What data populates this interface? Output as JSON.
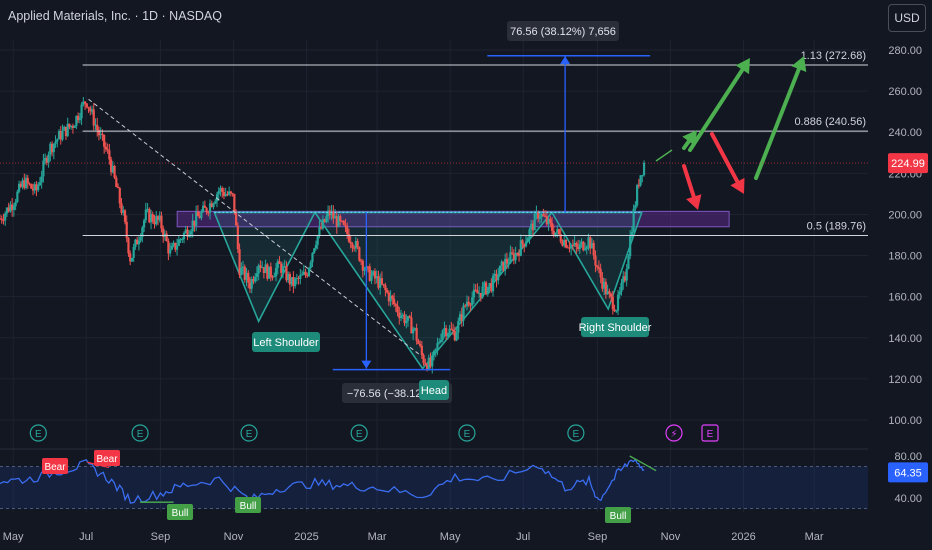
{
  "header": {
    "title": "Applied Materials, Inc. · 1D · NASDAQ",
    "currency_button": "USD"
  },
  "colors": {
    "background": "#131722",
    "grid": "#1f2330",
    "text": "#b2b5be",
    "candle_up": "#26a69a",
    "candle_down": "#ef5350",
    "pattern": "#26a69a",
    "measure": "#2962ff",
    "fib_line": "#d1d4dc",
    "zone": "#5b2a86",
    "arrow_up": "#4caf50",
    "arrow_down": "#f23645",
    "rsi_line": "#3a6df0",
    "price_label": "#f23645"
  },
  "chart_data": [
    {
      "type": "line",
      "name": "price",
      "x": [
        "2024-04-20",
        "2024-05-01",
        "2024-05-10",
        "2024-05-20",
        "2024-05-31",
        "2024-06-10",
        "2024-06-20",
        "2024-07-01",
        "2024-07-11",
        "2024-07-20",
        "2024-08-01",
        "2024-08-07",
        "2024-08-20",
        "2024-09-01",
        "2024-09-09",
        "2024-09-20",
        "2024-10-01",
        "2024-10-10",
        "2024-10-20",
        "2024-11-01",
        "2024-11-06",
        "2024-11-15",
        "2024-11-22",
        "2024-12-01",
        "2024-12-10",
        "2024-12-20",
        "2025-01-01",
        "2025-01-08",
        "2025-01-20",
        "2025-02-01",
        "2025-02-10",
        "2025-02-20",
        "2025-03-01",
        "2025-03-10",
        "2025-03-20",
        "2025-04-01",
        "2025-04-08",
        "2025-04-15",
        "2025-04-25",
        "2025-05-05",
        "2025-05-15",
        "2025-05-25",
        "2025-06-05",
        "2025-06-15",
        "2025-06-25",
        "2025-07-05",
        "2025-07-14",
        "2025-07-25",
        "2025-08-05",
        "2025-08-15",
        "2025-08-25",
        "2025-09-02",
        "2025-09-10",
        "2025-09-17",
        "2025-09-24",
        "2025-10-01",
        "2025-10-06",
        "2025-10-10"
      ],
      "y": [
        198,
        206,
        216,
        211,
        232,
        239,
        244,
        256,
        240,
        228,
        199,
        178,
        200,
        196,
        181,
        190,
        198,
        203,
        212,
        208,
        174,
        166,
        177,
        171,
        175,
        166,
        171,
        187,
        201,
        193,
        186,
        172,
        168,
        161,
        152,
        144,
        130,
        126,
        145,
        142,
        158,
        162,
        166,
        176,
        181,
        190,
        201,
        193,
        187,
        183,
        188,
        172,
        160,
        155,
        170,
        200,
        218,
        225
      ]
    },
    {
      "type": "line",
      "name": "RSI",
      "x": [
        "2024-04-20",
        "2024-05-15",
        "2024-06-10",
        "2024-07-01",
        "2024-07-20",
        "2024-08-07",
        "2024-09-01",
        "2024-09-20",
        "2024-10-20",
        "2024-11-15",
        "2024-12-10",
        "2025-01-08",
        "2025-02-01",
        "2025-03-01",
        "2025-04-08",
        "2025-05-05",
        "2025-06-05",
        "2025-07-14",
        "2025-08-05",
        "2025-08-25",
        "2025-09-02",
        "2025-09-17",
        "2025-10-01",
        "2025-10-10"
      ],
      "y": [
        56,
        58,
        66,
        72,
        58,
        38,
        44,
        52,
        58,
        38,
        50,
        54,
        52,
        50,
        42,
        60,
        56,
        72,
        50,
        56,
        38,
        62,
        78,
        67
      ]
    }
  ],
  "axes": {
    "y_ticks": [
      "280.00",
      "260.00",
      "240.00",
      "220.00",
      "200.00",
      "180.00",
      "160.00",
      "140.00",
      "120.00",
      "100.00"
    ],
    "rsi_ticks": [
      "80.00",
      "40.00"
    ],
    "x_ticks": [
      "May",
      "Jul",
      "Sep",
      "Nov",
      "2025",
      "Mar",
      "May",
      "Jul",
      "Sep",
      "Nov",
      "2026",
      "Mar"
    ],
    "price_label": "224.99",
    "rsi_label": "64.35"
  },
  "annotations": {
    "fib_high": "1.13 (272.68)",
    "fib_mid": "0.886 (240.56)",
    "fib_low": "0.5 (189.76)",
    "target_box": "76.56 (38.12%) 7,656",
    "drop_box": "−76.56 (−38.12%) ...",
    "left_shoulder": "Left Shoulder",
    "head": "Head",
    "right_shoulder": "Right Shoulder",
    "bear_1": "Bear",
    "bear_2": "Bear",
    "bull_1": "Bull",
    "bull_2": "Bull",
    "bull_3": "Bull",
    "earnings": "E"
  }
}
